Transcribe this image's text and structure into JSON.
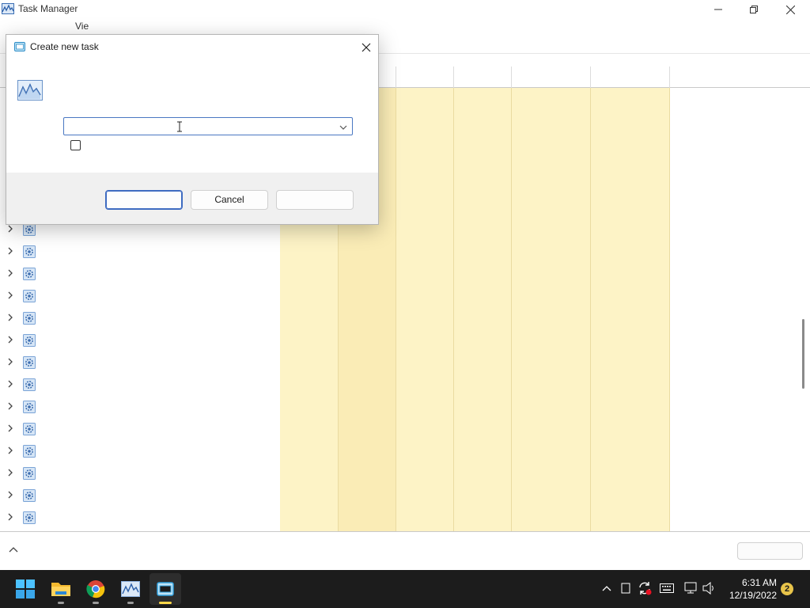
{
  "window": {
    "title": "Task Manager",
    "menu_view_label": "Vie"
  },
  "dialog": {
    "title": "Create new task",
    "input_value": "",
    "checkbox_checked": false,
    "buttons": {
      "ok": "",
      "cancel": "Cancel",
      "browse": ""
    }
  },
  "table": {
    "rows": [
      {
        "icon": "gear-icon"
      },
      {
        "icon": "gear-icon"
      },
      {
        "icon": "gear-icon"
      },
      {
        "icon": "gear-icon"
      },
      {
        "icon": "gear-icon"
      },
      {
        "icon": "gear-icon"
      },
      {
        "icon": "gear-icon"
      },
      {
        "icon": "gear-icon"
      },
      {
        "icon": "gear-icon"
      },
      {
        "icon": "gear-icon"
      },
      {
        "icon": "gear-icon"
      },
      {
        "icon": "gear-icon"
      },
      {
        "icon": "gear-icon"
      },
      {
        "icon": "gear-icon"
      }
    ]
  },
  "taskbar": {
    "apps": [
      {
        "name": "start",
        "icon": "windows-logo-icon"
      },
      {
        "name": "file-explorer",
        "icon": "folder-icon"
      },
      {
        "name": "chrome",
        "icon": "chrome-icon"
      },
      {
        "name": "task-manager",
        "icon": "task-manager-icon"
      },
      {
        "name": "run",
        "icon": "run-dialog-icon",
        "active": true
      }
    ],
    "clock": {
      "time": "6:31 AM",
      "date": "12/19/2022"
    },
    "notification_count": "2"
  },
  "colors": {
    "accent": "#3e6bc1",
    "column_highlight": "#fdf3c6",
    "column_highlight_strong": "#faecb6",
    "taskbar": "#1c1c1c",
    "badge": "#e8c44a"
  }
}
